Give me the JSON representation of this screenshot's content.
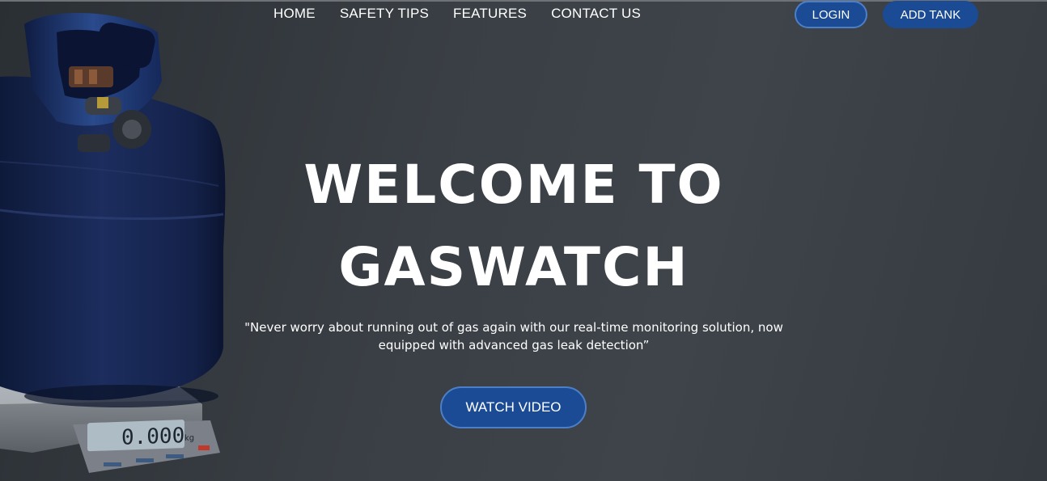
{
  "nav": {
    "items": [
      {
        "label": "HOME"
      },
      {
        "label": "SAFETY TIPS"
      },
      {
        "label": "FEATURES"
      },
      {
        "label": "CONTACT US"
      }
    ]
  },
  "header": {
    "login_label": "LOGIN",
    "add_tank_label": "ADD TANK"
  },
  "hero": {
    "title_line1": "WELCOME TO",
    "title_line2": "GASWATCH",
    "subtitle_line1": "\"Never worry about running out of gas again with our real-time monitoring solution, now",
    "subtitle_line2": "equipped with advanced gas leak detection”",
    "watch_video_label": "WATCH VIDEO",
    "illustration": {
      "icon": "gas-tank-on-scale-illustration",
      "scale_readout": "0.000",
      "scale_unit": "kg"
    }
  },
  "colors": {
    "button_bg": "#1b4b94",
    "button_border": "#4d7fc8",
    "background": "#3a3f45",
    "tank": "#1a2a55"
  }
}
